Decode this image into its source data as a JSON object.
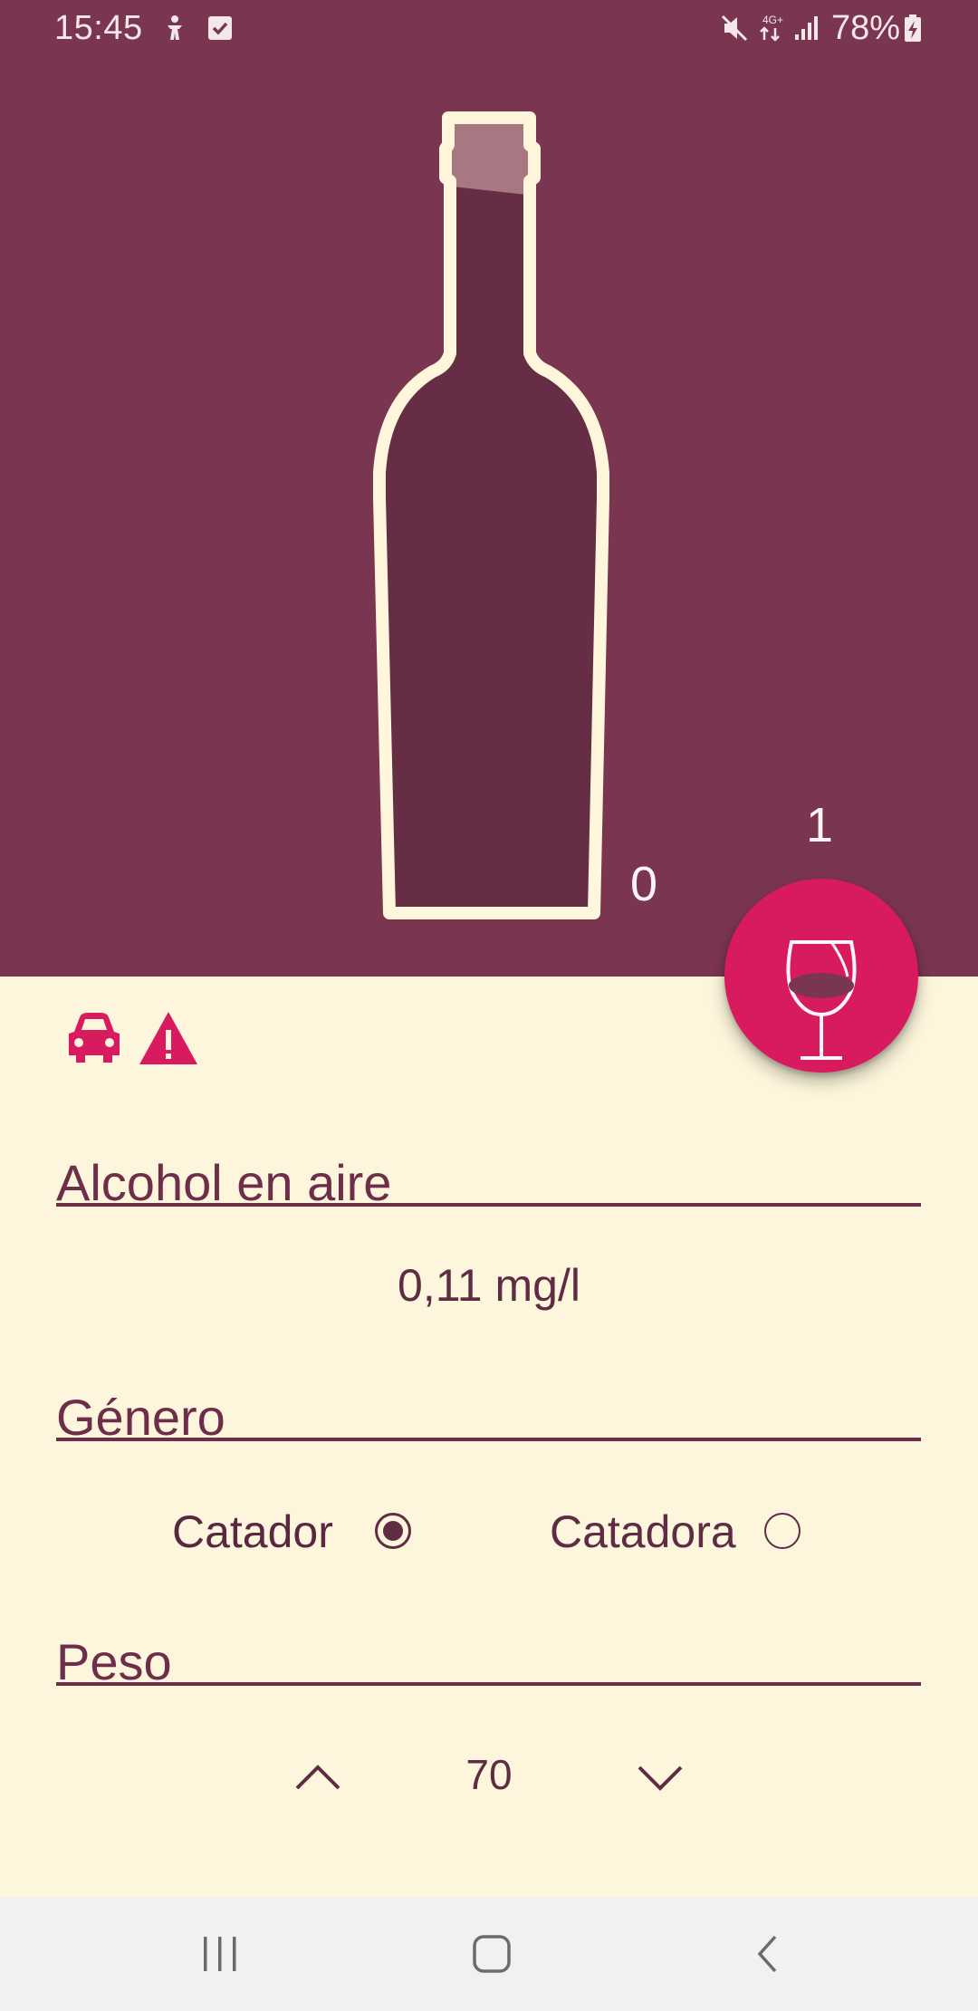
{
  "status_bar": {
    "time": "15:45",
    "battery": "78%",
    "network": "4G+",
    "icons": [
      "accessibility-icon",
      "checkbox-notification-icon",
      "mute-icon",
      "data-arrows-icon",
      "signal-icon",
      "battery-charging-icon"
    ]
  },
  "bottle": {
    "count": "0"
  },
  "glass": {
    "count": "1",
    "icon": "wine-glass-icon"
  },
  "warnings": {
    "icons": [
      "car-icon",
      "warning-icon"
    ],
    "color": "#d81b5e"
  },
  "alcohol": {
    "label": "Alcohol en aire",
    "value": "0,11 mg/l"
  },
  "gender": {
    "label": "Género",
    "options": [
      {
        "label": "Catador",
        "selected": true
      },
      {
        "label": "Catadora",
        "selected": false
      }
    ]
  },
  "weight": {
    "label": "Peso",
    "value": "70",
    "increase_icon": "chevron-up-icon",
    "decrease_icon": "chevron-down-icon"
  },
  "nav": {
    "icons": [
      "recents-icon",
      "home-icon",
      "back-icon"
    ]
  },
  "colors": {
    "hero_bg": "#7a3551",
    "content_bg": "#fdf6dc",
    "accent": "#d81b5e",
    "text": "#5e2c43",
    "bottle_outline": "#fff6dc",
    "bottle_fill": "#652e45"
  }
}
